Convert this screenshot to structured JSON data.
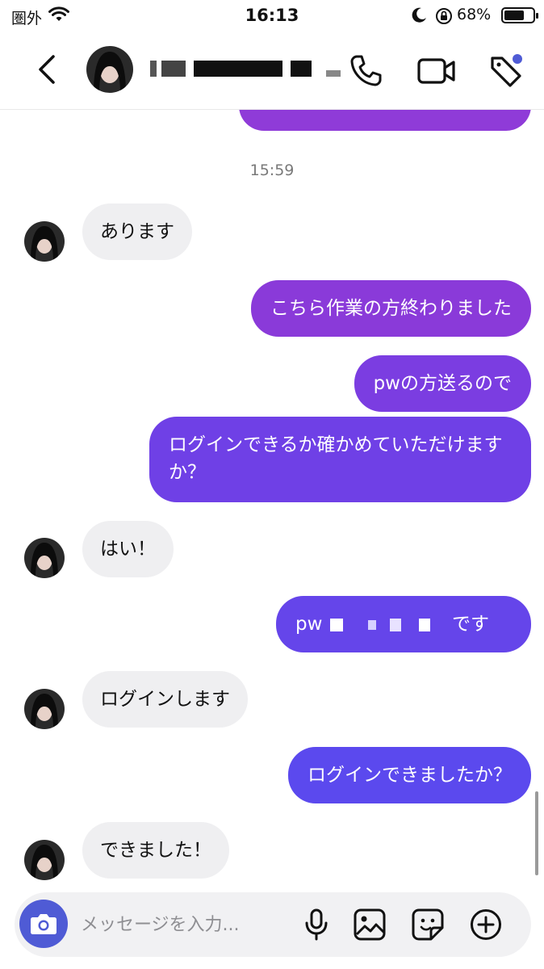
{
  "status_bar": {
    "carrier": "圏外",
    "time": "16:13",
    "battery": "68%"
  },
  "header": {
    "back_icon": "chevron-left-icon",
    "call_icon": "phone-icon",
    "video_icon": "video-camera-icon",
    "tag_icon": "tag-icon"
  },
  "colors": {
    "accent": "#4f5bd5",
    "bubble_in": "#efeff1",
    "bubble_out_top": "#8b3ad6",
    "bubble_out_bottom": "#5b4cf0"
  },
  "chat": {
    "timestamp": "15:59",
    "messages": [
      {
        "from": "them",
        "text": "あります"
      },
      {
        "from": "me",
        "text": "こちら作業の方終わりました"
      },
      {
        "from": "me",
        "text": "pwの方送るので"
      },
      {
        "from": "me",
        "text": "ログインできるか確かめていただけますか？"
      },
      {
        "from": "them",
        "text": "はい！"
      },
      {
        "from": "me",
        "text_prefix": "pw",
        "text_suffix": "です"
      },
      {
        "from": "them",
        "text": "ログインします"
      },
      {
        "from": "me",
        "text": "ログインできましたか？"
      },
      {
        "from": "them",
        "text": "できました！"
      }
    ]
  },
  "composer": {
    "placeholder": "メッセージを入力..."
  }
}
